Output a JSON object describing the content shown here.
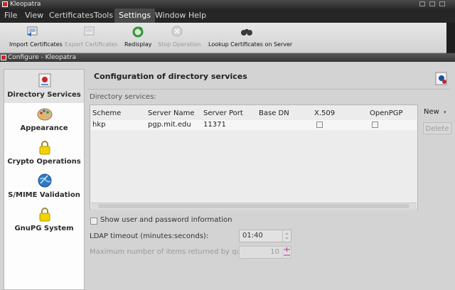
{
  "main_window": {
    "title": "Kleopatra",
    "menu": [
      "File",
      "View",
      "Certificates",
      "Tools",
      "Settings",
      "Window",
      "Help"
    ],
    "active_menu": "Settings",
    "toolbar": {
      "import": "Import Certificates",
      "export": "Export Certificates",
      "redisplay": "Redisplay",
      "stop": "Stop Operation",
      "lookup": "Lookup Certificates on Server"
    }
  },
  "dialog": {
    "title": "Configure - Kleopatra",
    "sidebar": [
      {
        "label": "Directory Services",
        "icon": "directory-icon",
        "selected": true
      },
      {
        "label": "Appearance",
        "icon": "palette-icon"
      },
      {
        "label": "Crypto Operations",
        "icon": "lock-icon"
      },
      {
        "label": "S/MIME Validation",
        "icon": "globe-icon"
      },
      {
        "label": "GnuPG System",
        "icon": "lock-icon"
      }
    ],
    "page_title": "Configuration of directory services",
    "directory_services_label": "Directory services:",
    "table": {
      "columns": [
        "Scheme",
        "Server Name",
        "Server Port",
        "Base DN",
        "X.509",
        "OpenPGP"
      ],
      "rows": [
        {
          "scheme": "hkp",
          "server_name": "pgp.mit.edu",
          "server_port": "11371",
          "base_dn": "",
          "x509": false,
          "openpgp": false
        }
      ]
    },
    "new_button": "New",
    "delete_button": "Delete",
    "show_user_password": "Show user and password information",
    "ldap_timeout_label": "LDAP timeout (minutes:seconds):",
    "ldap_timeout_value": "01:40",
    "max_items_label": "Maximum number of items returned by query:",
    "max_items_value": "10"
  }
}
